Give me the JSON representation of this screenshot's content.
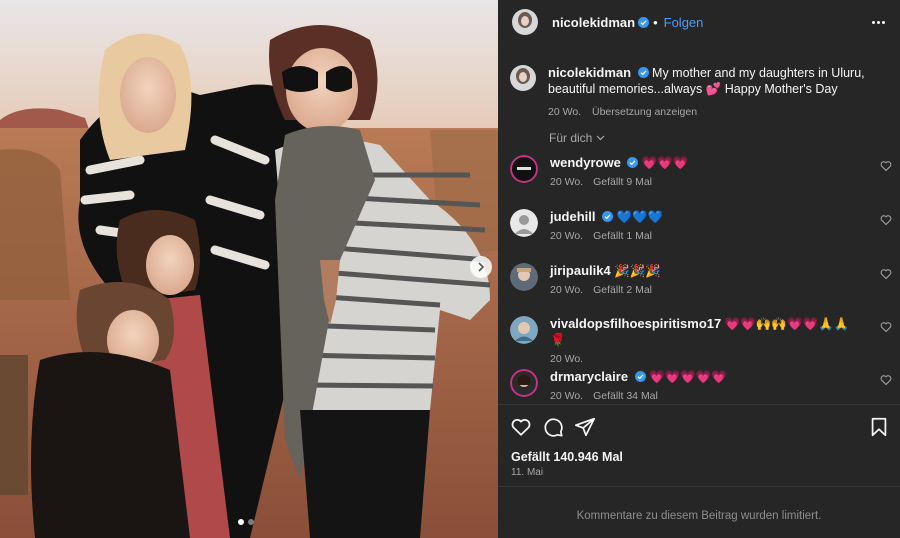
{
  "post": {
    "author": "nicolekidman",
    "follow_label": "Folgen",
    "separator": "•",
    "caption": {
      "username": "nicolekidman",
      "text": "My mother and my daughters in Uluru, beautiful memories...always",
      "emoji": "💕",
      "text_end": "Happy Mother's Day",
      "age": "20 Wo.",
      "translate_label": "Übersetzung anzeigen"
    },
    "for_you_label": "Für dich",
    "comments": [
      {
        "username": "wendyrowe",
        "verified": true,
        "text": "💗💗💗",
        "age": "20 Wo.",
        "likes": "Gefällt 9 Mal"
      },
      {
        "username": "judehill",
        "verified": true,
        "text": "💙💙💙",
        "age": "20 Wo.",
        "likes": "Gefällt 1 Mal"
      },
      {
        "username": "jiripaulik4",
        "verified": false,
        "text": "🎉🎉🎉",
        "age": "20 Wo.",
        "likes": "Gefällt 2 Mal"
      },
      {
        "username": "vivaldopsfilhoespiritismo17",
        "verified": false,
        "text": "💗💗🙌🙌💗💗🙏🙏🌹",
        "age": "20 Wo.",
        "likes": ""
      },
      {
        "username": "drmaryclaire",
        "verified": true,
        "text": "💗💗💗💗💗",
        "age": "20 Wo.",
        "likes": "Gefällt 34 Mal"
      }
    ],
    "likes_label": "Gefällt 140.946 Mal",
    "date_label": "11. Mai",
    "comments_limited": "Kommentare zu diesem Beitrag wurden limitiert.",
    "carousel": {
      "current": 1,
      "total": 2
    }
  },
  "icons": {
    "verified": "verified-badge-icon",
    "more": "more-options-icon",
    "chevron": "chevron-down-icon",
    "like": "heart-icon",
    "comment": "comment-icon",
    "share": "share-icon",
    "save": "bookmark-icon",
    "next": "chevron-right-icon"
  },
  "colors": {
    "accent": "#4c9cf5",
    "panel_bg": "#262626",
    "muted": "#a8a8a8",
    "verified": "#3897f0"
  }
}
